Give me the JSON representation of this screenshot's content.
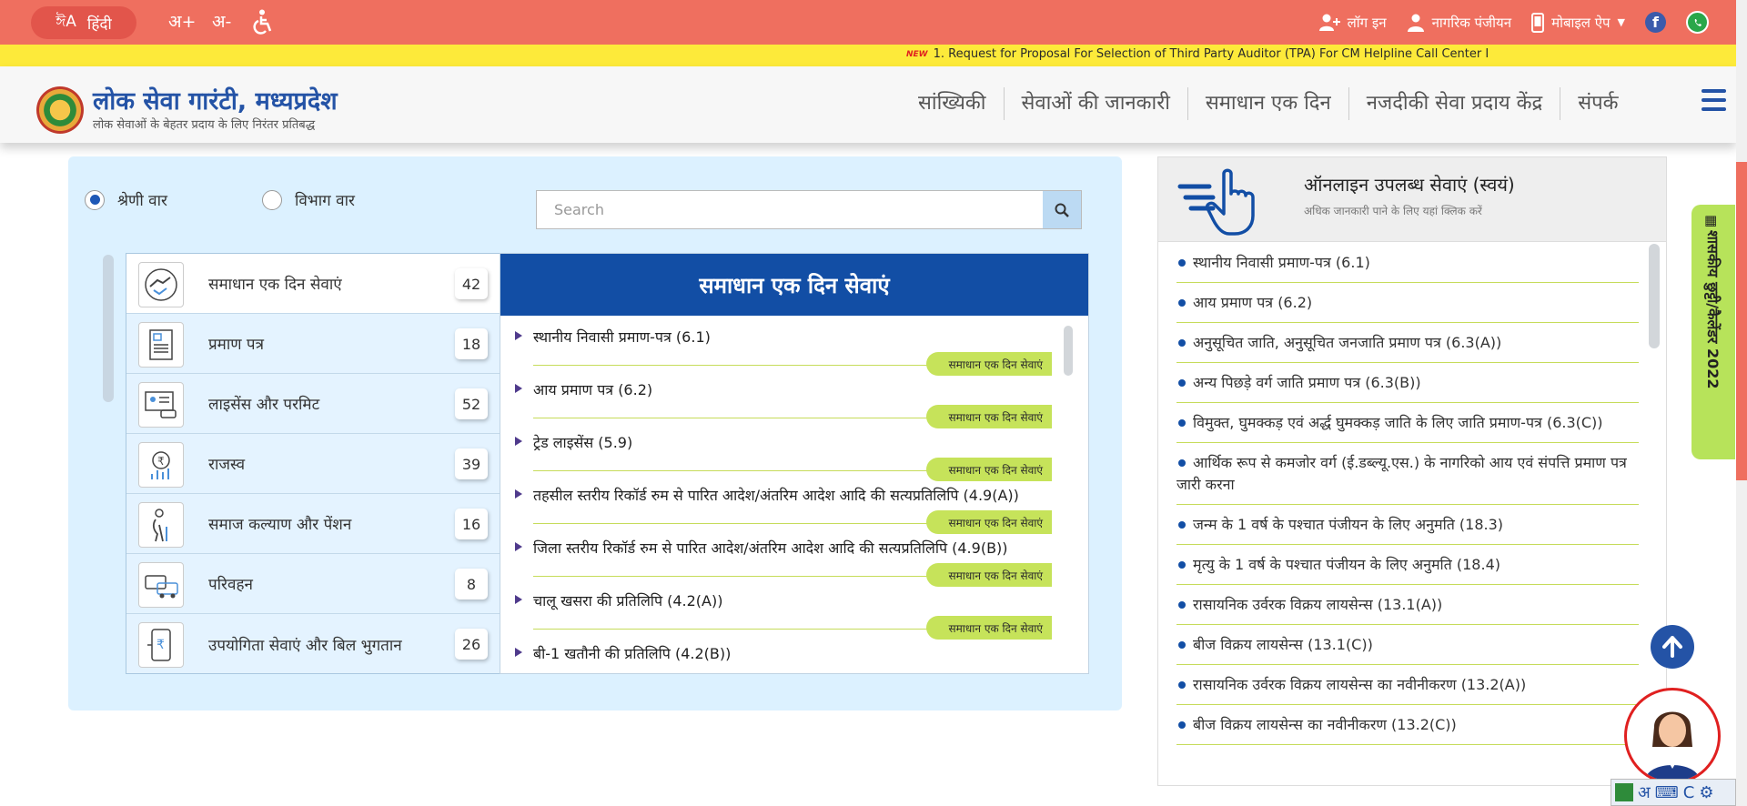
{
  "topbar": {
    "lang_icon": "translate-icon",
    "lang_label": "हिंदी",
    "font_increase": "अ+",
    "font_decrease": "अ-",
    "login": "लॉग इन",
    "register": "नागरिक पंजीयन",
    "mobile_app": "मोबाइल ऐप"
  },
  "ticker": {
    "badge": "NEW",
    "text": "1. Request for Proposal For Selection of Third Party Auditor (TPA) For CM Helpline Call Center I"
  },
  "header": {
    "title": "लोक सेवा गारंटी, मध्यप्रदेश",
    "subtitle": "लोक सेवाओं के बेहतर प्रदाय के लिए निरंतर प्रतिबद्ध",
    "nav": [
      "सांख्यिकी",
      "सेवाओं की जानकारी",
      "समाधान एक दिन",
      "नजदीकी सेवा प्रदाय केंद्र",
      "संपर्क"
    ]
  },
  "filters": {
    "category_radio": "श्रेणी वार",
    "department_radio": "विभाग वार",
    "search_placeholder": "Search"
  },
  "categories": [
    {
      "label": "समाधान एक दिन सेवाएं",
      "count": "42",
      "icon": "handshake-icon"
    },
    {
      "label": "प्रमाण पत्र",
      "count": "18",
      "icon": "certificate-icon"
    },
    {
      "label": "लाइसेंस और परमिट",
      "count": "52",
      "icon": "license-icon"
    },
    {
      "label": "राजस्व",
      "count": "39",
      "icon": "rupee-icon"
    },
    {
      "label": "समाज कल्याण और पेंशन",
      "count": "16",
      "icon": "elderly-icon"
    },
    {
      "label": "परिवहन",
      "count": "8",
      "icon": "vehicle-icon"
    },
    {
      "label": "उपयोगिता सेवाएं और बिल भुगतान",
      "count": "26",
      "icon": "bill-icon"
    }
  ],
  "services": {
    "heading": "समाधान एक दिन सेवाएं",
    "tag": "समाधान एक दिन सेवाएं",
    "items": [
      "स्थानीय निवासी प्रमाण-पत्र (6.1)",
      "आय प्रमाण पत्र (6.2)",
      "ट्रेड लाइसेंस (5.9)",
      "तहसील स्तरीय रिकॉर्ड रुम से पारित आदेश/अंतरिम आदेश आदि की सत्यप्रतिलिपि (4.9(A))",
      "जिला स्तरीय रिकॉर्ड रुम से पारित आदेश/अंतरिम आदेश आदि की सत्यप्रतिलिपि (4.9(B))",
      "चालू खसरा की प्रतिलिपि (4.2(A))",
      "बी-1 खतौनी की प्रतिलिपि (4.2(B))"
    ]
  },
  "online": {
    "title": "ऑनलाइन उपलब्ध सेवाएं (स्वयं)",
    "subtitle": "अधिक जानकारी पाने के लिए यहां क्लिक करें",
    "items": [
      "स्थानीय निवासी प्रमाण-पत्र (6.1)",
      "आय प्रमाण पत्र (6.2)",
      "अनुसूचित जाति, अनुसूचित जनजाति प्रमाण पत्र (6.3(A))",
      "अन्य पिछड़े वर्ग जाति प्रमाण पत्र (6.3(B))",
      "विमुक्त, घुमक्कड़ एवं अर्द्ध घुमक्कड़ जाति के लिए जाति प्रमाण-पत्र (6.3(C))",
      "आर्थिक रूप से कमजोर वर्ग (ई.डब्ल्यू.एस.) के नागरिको आय एवं संपत्ति प्रमाण पत्र जारी करना",
      "जन्म के 1 वर्ष के पश्चात पंजीयन के लिए अनुमति (18.3)",
      "मृत्यु के 1 वर्ष के पश्चात पंजीयन के लिए अनुमति (18.4)",
      "रासायनिक उर्वरक विक्रय लायसेन्स (13.1(A))",
      "बीज विक्रय लायसेन्स (13.1(C))",
      "रासायनिक उर्वरक विक्रय लायसेन्स का नवीनीकरण (13.2(A))",
      "बीज विक्रय लायसेन्स का नवीनीकरण (13.2(C))"
    ]
  },
  "side_tab": "शासकीय छुट्टी/कैलेंडर 2022",
  "keyboard": {
    "hindi_char": "अ"
  }
}
